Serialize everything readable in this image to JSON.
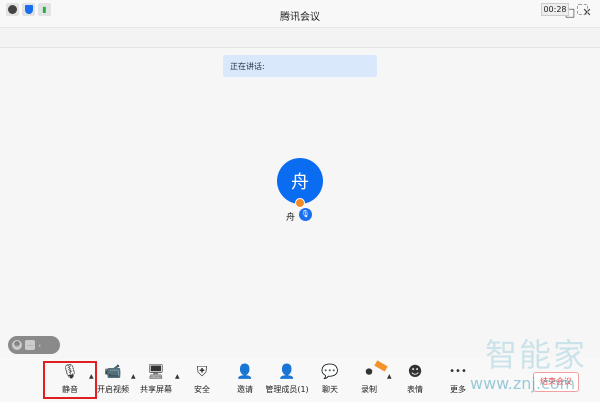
{
  "window": {
    "title": "腾讯会议",
    "minimize": "—",
    "maximize": "□",
    "close": "✕"
  },
  "infobar": {
    "timer": "00:28"
  },
  "speaking": {
    "label": "正在讲话:"
  },
  "participant": {
    "avatar_char": "舟",
    "name": "舟"
  },
  "toolbar": [
    {
      "label": "静音",
      "icon": "microphone-icon",
      "glyph": "🎙"
    },
    {
      "label": "开启视频",
      "icon": "video-off-icon",
      "glyph": "📹"
    },
    {
      "label": "共享屏幕",
      "icon": "share-screen-icon",
      "glyph": "🖥"
    },
    {
      "label": "安全",
      "icon": "shield-icon",
      "glyph": "⛨"
    },
    {
      "label": "邀请",
      "icon": "invite-icon",
      "glyph": "👤"
    },
    {
      "label": "管理成员(1)",
      "icon": "members-icon",
      "glyph": "👤"
    },
    {
      "label": "聊天",
      "icon": "chat-icon",
      "glyph": "💬"
    },
    {
      "label": "录制",
      "icon": "record-icon",
      "glyph": "⏺"
    },
    {
      "label": "表情",
      "icon": "emoji-icon",
      "glyph": "☻"
    },
    {
      "label": "更多",
      "icon": "more-icon",
      "glyph": "•••"
    }
  ],
  "end_meeting": "结束会议",
  "watermark": {
    "line1": "智能家",
    "line2": "www.znj.com"
  }
}
